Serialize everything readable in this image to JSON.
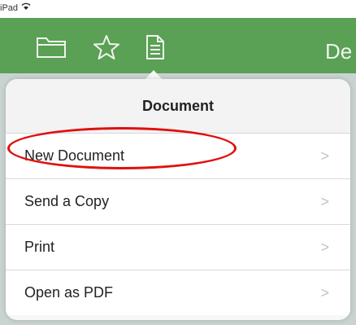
{
  "status_bar": {
    "device": "iPad"
  },
  "toolbar": {
    "icons": [
      "folder-icon",
      "star-icon",
      "document-icon"
    ],
    "title_fragment": "De"
  },
  "popover": {
    "title": "Document",
    "items": [
      {
        "label": "New Document"
      },
      {
        "label": "Send a Copy"
      },
      {
        "label": "Print"
      },
      {
        "label": "Open as PDF"
      }
    ],
    "chevron": ">"
  },
  "colors": {
    "toolbar_green": "#5aa055",
    "highlight_red": "#e01010"
  }
}
